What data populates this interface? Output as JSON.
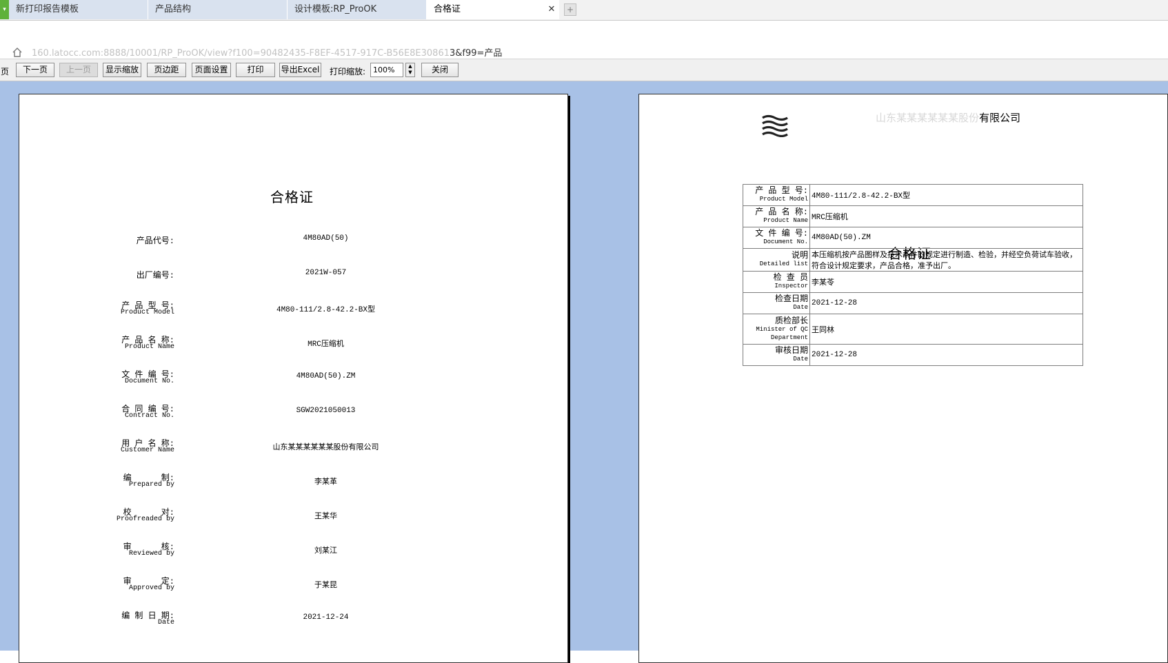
{
  "tabs": [
    {
      "label": "新打印报告模板",
      "active": false
    },
    {
      "label": "产品结构",
      "active": false
    },
    {
      "label": "设计模板:RP_ProOK",
      "active": false
    },
    {
      "label": "合格证",
      "active": true
    }
  ],
  "address": {
    "url_blurred": "160.latocc.com:8888/10001/RP_ProOK/view?f100=90482435-F8EF-4517-917C-B56E8E30861",
    "url_tail": "3&f99=产品"
  },
  "toolbar": {
    "page_label": "页",
    "next_label": "下一页",
    "prev_label": "上一页",
    "show_zoom_label": "显示缩放",
    "margin_label": "页边距",
    "page_setup_label": "页面设置",
    "print_label": "打印",
    "export_label": "导出Excel",
    "zoom_label": "打印缩放:",
    "zoom_value": "100%",
    "close_label": "关闭"
  },
  "left_page": {
    "title": "合格证",
    "rows": [
      {
        "cn": "产品代号:",
        "en": "",
        "value": "4M80AD(50)"
      },
      {
        "cn": "出厂编号:",
        "en": "",
        "value": "2021W-057"
      },
      {
        "cn": "产 品 型 号:",
        "en": "Product Model",
        "value": "4M80-111/2.8-42.2-BX型"
      },
      {
        "cn": "产 品 名 称:",
        "en": "Product Name",
        "value": "MRC压缩机"
      },
      {
        "cn": "文 件 编 号:",
        "en": "Document No.",
        "value": "4M80AD(50).ZM"
      },
      {
        "cn": "合 同 编 号:",
        "en": "Contract No.",
        "value": "SGW2021050013"
      },
      {
        "cn": "用 户 名 称:",
        "en": "Customer Name",
        "value": "山东某某某某某某股份有限公司"
      },
      {
        "cn": "编      制:",
        "en": "Prepared by",
        "value": "李某革"
      },
      {
        "cn": "校      对:",
        "en": "Proofreaded by",
        "value": "王某华"
      },
      {
        "cn": "审      核:",
        "en": "Reviewed by",
        "value": "刘某江"
      },
      {
        "cn": "审      定:",
        "en": "Approved by",
        "value": "于某昆"
      },
      {
        "cn": "编 制 日 期:",
        "en": "Date",
        "value": "2021-12-24"
      }
    ]
  },
  "right_page": {
    "company_blurred": "山东某某某某某某股份",
    "company_tail": "有限公司",
    "title": "合格证",
    "rows": [
      {
        "cn": "产 品 型 号:",
        "en": "Product Model",
        "value": "4M80-111/2.8-42.2-BX型"
      },
      {
        "cn": "产 品 名 称:",
        "en": "Product Name",
        "value": "MRC压缩机"
      },
      {
        "cn": "文 件 编 号:",
        "en": "Document No.",
        "value": "4M80AD(50).ZM"
      },
      {
        "cn": "说明",
        "en": "Detailed list",
        "value": "本压缩机按产品图样及技术条件的规定进行制造、检验，并经空负荷试车验收，符合设计规定要求，产品合格，准予出厂。"
      },
      {
        "cn": "检 查 员",
        "en": "Inspector",
        "value": "李某苓"
      },
      {
        "cn": "检查日期",
        "en": "Date",
        "value": "2021-12-28"
      },
      {
        "cn": "质检部长",
        "en": "Minister of QC Department",
        "value": "王同林"
      },
      {
        "cn": "审核日期",
        "en": "Date",
        "value": "2021-12-28"
      }
    ]
  },
  "colors": {
    "viewer_bg": "#a8c1e6",
    "tab_inactive": "#d9e2ef",
    "tab_active": "#ffffff",
    "accent_green": "#5fb13a"
  }
}
